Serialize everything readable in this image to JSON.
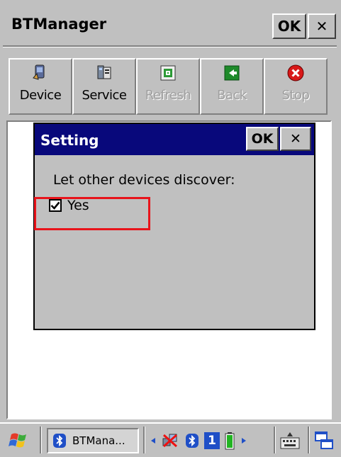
{
  "window": {
    "title": "BTManager",
    "ok_label": "OK",
    "close_label": "✕"
  },
  "toolbar": [
    {
      "label": "Device",
      "icon": "device-icon",
      "enabled": true
    },
    {
      "label": "Service",
      "icon": "service-icon",
      "enabled": true
    },
    {
      "label": "Refresh",
      "icon": "refresh-icon",
      "enabled": false
    },
    {
      "label": "Back",
      "icon": "back-arrow-icon",
      "enabled": false
    },
    {
      "label": "Stop",
      "icon": "stop-icon",
      "enabled": false
    }
  ],
  "dialog": {
    "title": "Setting",
    "ok_label": "OK",
    "close_label": "✕",
    "prompt": "Let other devices discover:",
    "checkbox": {
      "label": "Yes",
      "checked": true
    }
  },
  "taskbar": {
    "active_task": "BTMana...",
    "tray_number": "1"
  },
  "colors": {
    "dialog_title_bg": "#08087b",
    "highlight": "#e8141b",
    "window_bg": "#c0c0c0"
  }
}
